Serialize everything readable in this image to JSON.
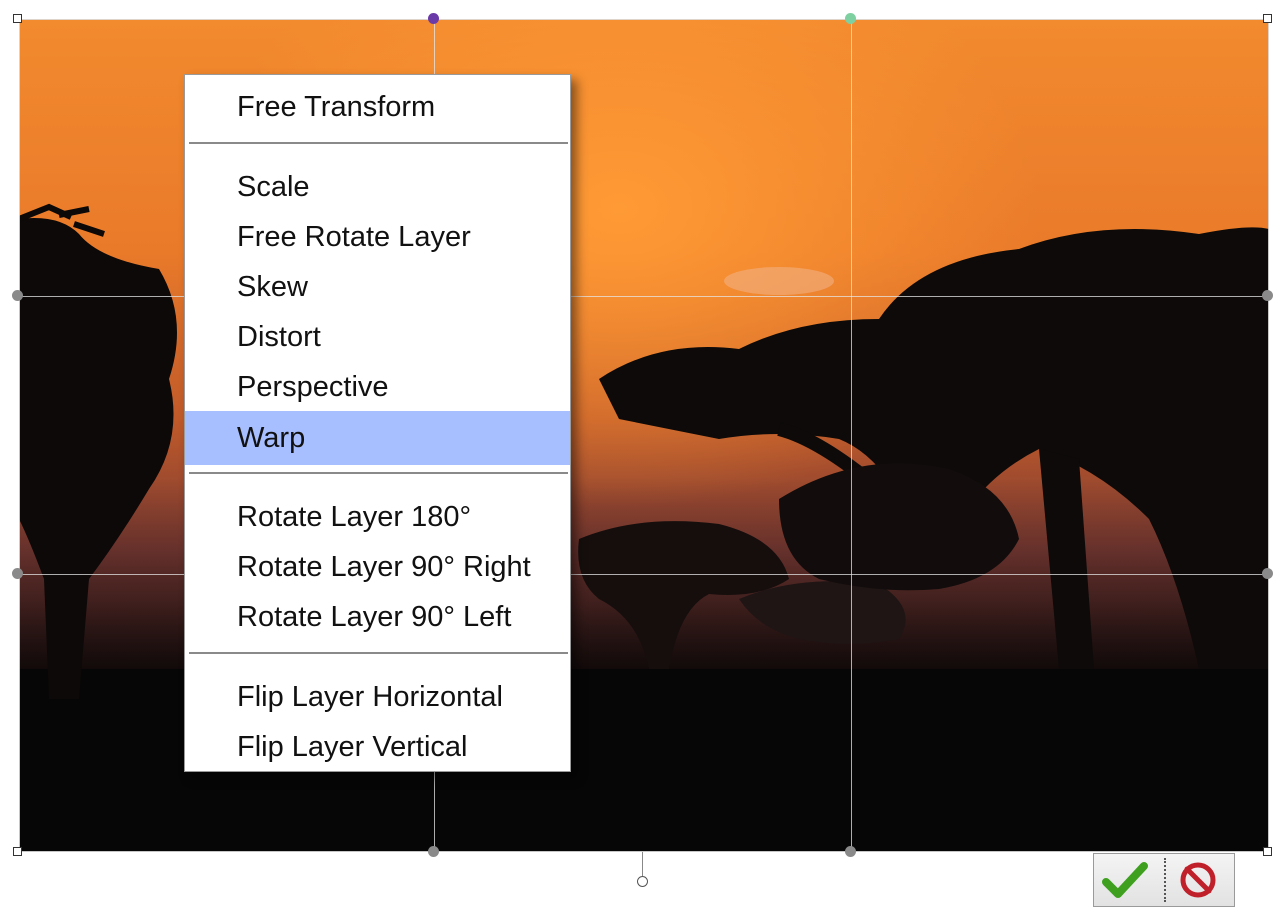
{
  "context_menu": {
    "items": [
      {
        "label": "Free Transform"
      },
      {
        "label": "Scale"
      },
      {
        "label": "Free Rotate Layer"
      },
      {
        "label": "Skew"
      },
      {
        "label": "Distort"
      },
      {
        "label": "Perspective"
      },
      {
        "label": "Warp",
        "selected": true
      },
      {
        "label": "Rotate Layer 180°"
      },
      {
        "label": "Rotate Layer 90° Right"
      },
      {
        "label": "Rotate Layer 90° Left"
      },
      {
        "label": "Flip Layer Horizontal"
      },
      {
        "label": "Flip Layer Vertical"
      }
    ],
    "highlight_color": "#a8bfff"
  },
  "toolbar": {
    "commit_icon": "check-icon",
    "cancel_icon": "no-entry-icon",
    "commit_color": "#3fa020",
    "cancel_color": "#c0202a"
  },
  "colors": {
    "sky_orange": "#f28a2e",
    "silhouette": "#0a0808"
  }
}
